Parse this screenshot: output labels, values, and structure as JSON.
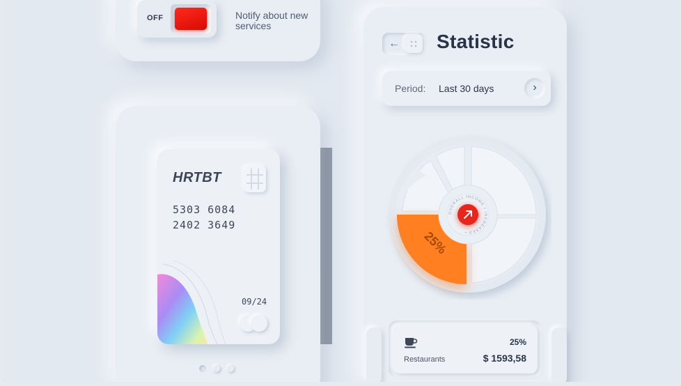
{
  "toggle": {
    "state_label": "OFF",
    "description": "Notify about new services"
  },
  "card": {
    "brand": "HRTBT",
    "number_line1": "5303 6084",
    "number_line2": "2402 3649",
    "expiry": "09/24"
  },
  "carousel": {
    "dot_count": 3,
    "active_index": 0
  },
  "statistic": {
    "title": "Statistic",
    "period_label": "Period:",
    "period_value": "Last 30 days",
    "donut": {
      "highlighted_percent_label": "25%",
      "highlight_color": "#ff7a1f",
      "center_color": "#e8271c",
      "ring_text": "OVERALL INCOME • INCREASED • "
    },
    "category": {
      "icon": "coffee-cup-icon",
      "name": "Restaurants",
      "percent": "25%",
      "amount": "$ 1593,58"
    }
  }
}
